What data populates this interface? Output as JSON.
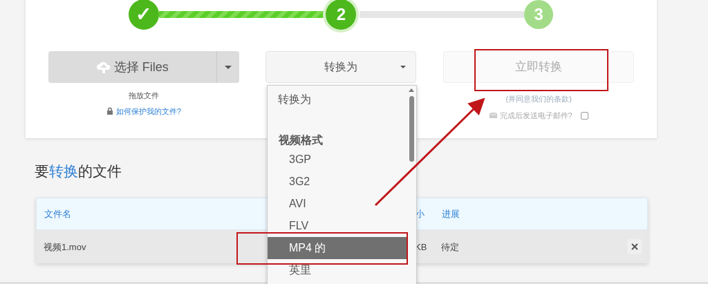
{
  "steps": [
    {
      "label": "✓",
      "kind": "done"
    },
    {
      "label": "2",
      "kind": "current"
    },
    {
      "label": "3",
      "kind": "upcoming"
    }
  ],
  "upload": {
    "button": "选择 Files",
    "hint": "拖放文件",
    "link": "如何保护我的文件?"
  },
  "convert_select": {
    "value": "转换为",
    "expanded": true
  },
  "convert_button": {
    "label": "立即转换",
    "disabled": true,
    "terms": "(并同意我们的条款)",
    "email_label": "完成后发送电子邮件?",
    "email_checked": false
  },
  "files_heading": "要**转换**的文件",
  "table": {
    "columns": [
      {
        "label": "文件名"
      },
      {
        "label": "小"
      },
      {
        "label": "进展"
      }
    ],
    "rows": [
      {
        "name": "视频1.mov",
        "size": "KB",
        "status": "待定"
      }
    ]
  },
  "dropdown": {
    "items": [
      {
        "label": "转换为",
        "kind": "placeholder"
      },
      {
        "label": "视频格式",
        "kind": "group"
      },
      {
        "label": "3GP",
        "kind": "option",
        "selected": false
      },
      {
        "label": "3G2",
        "kind": "option",
        "selected": false
      },
      {
        "label": "AVI",
        "kind": "option",
        "selected": false
      },
      {
        "label": "FLV",
        "kind": "option",
        "selected": false
      },
      {
        "label": "MP4 的",
        "kind": "option",
        "selected": true
      },
      {
        "label": "英里",
        "kind": "option",
        "selected": false
      }
    ]
  }
}
